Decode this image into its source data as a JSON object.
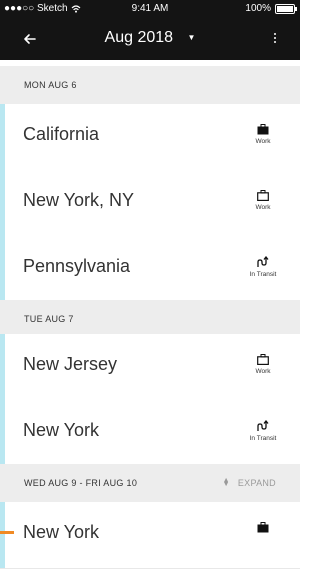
{
  "status_bar": {
    "carrier": "●●●○○ Sketch",
    "time": "9:41 AM",
    "battery": "100%"
  },
  "app_bar": {
    "title": "Aug 2018",
    "back_icon": "arrow-left-icon",
    "menu_icon": "more-vert-icon",
    "dropdown_icon": "caret-down-icon"
  },
  "sections": [
    {
      "label": "MON AUG 6",
      "rows": [
        {
          "name": "California",
          "kind": "Work",
          "icon": "briefcase-filled-icon"
        },
        {
          "name": "New York, NY",
          "kind": "Work",
          "icon": "briefcase-outline-icon"
        },
        {
          "name": "Pennsylvania",
          "kind": "In Transit",
          "icon": "transit-route-icon"
        }
      ]
    },
    {
      "label": "TUE AUG 7",
      "rows": [
        {
          "name": "New Jersey",
          "kind": "Work",
          "icon": "briefcase-outline-icon"
        },
        {
          "name": "New York",
          "kind": "In Transit",
          "icon": "transit-route-icon"
        }
      ]
    },
    {
      "label": "WED AUG 9 - FRI AUG 10",
      "expand_label": "EXPAND",
      "rows": [
        {
          "name": "New York",
          "kind": "",
          "icon": "briefcase-filled-icon"
        }
      ]
    }
  ],
  "colors": {
    "bar": "#141414",
    "accent": "#b9e7f1",
    "section_bg": "#ededed",
    "marker": "#f08a24"
  }
}
